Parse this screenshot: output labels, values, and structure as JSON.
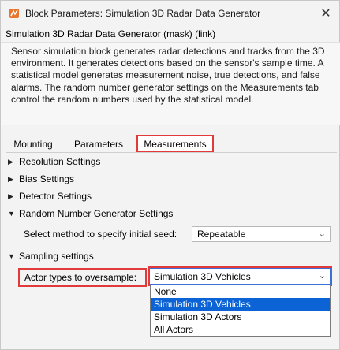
{
  "window": {
    "title": "Block Parameters: Simulation 3D Radar Data Generator",
    "close_glyph": "✕"
  },
  "header": {
    "mask_title": "Simulation 3D Radar Data Generator (mask) (link)"
  },
  "description": "Sensor simulation block generates radar detections and tracks from the 3D environment. It generates detections based on the sensor's sample time. A statistical model generates measurement noise, true detections, and false alarms. The random number generator settings on the Measurements tab control the random numbers used by the statistical model.",
  "tabs": [
    {
      "label": "Mounting"
    },
    {
      "label": "Parameters"
    },
    {
      "label": "Measurements"
    }
  ],
  "sections": {
    "resolution": {
      "label": "Resolution Settings",
      "expanded": false
    },
    "bias": {
      "label": "Bias Settings",
      "expanded": false
    },
    "detector": {
      "label": "Detector Settings",
      "expanded": false
    },
    "rng": {
      "label": "Random Number Generator Settings",
      "expanded": true
    },
    "sampling": {
      "label": "Sampling settings",
      "expanded": true
    }
  },
  "rng": {
    "seed_label": "Select method to specify initial seed:",
    "seed_value": "Repeatable"
  },
  "sampling": {
    "actor_label": "Actor types to oversample:",
    "actor_value": "Simulation 3D Vehicles",
    "options": [
      "None",
      "Simulation 3D Vehicles",
      "Simulation 3D Actors",
      "All Actors"
    ],
    "selected_index": 1
  },
  "icons": {
    "collapsed": "▶",
    "expanded": "▼",
    "chevron": "⌄"
  },
  "colors": {
    "highlight": "#e03a3a",
    "selection": "#0b63d6",
    "focus": "#3d6fd6"
  }
}
